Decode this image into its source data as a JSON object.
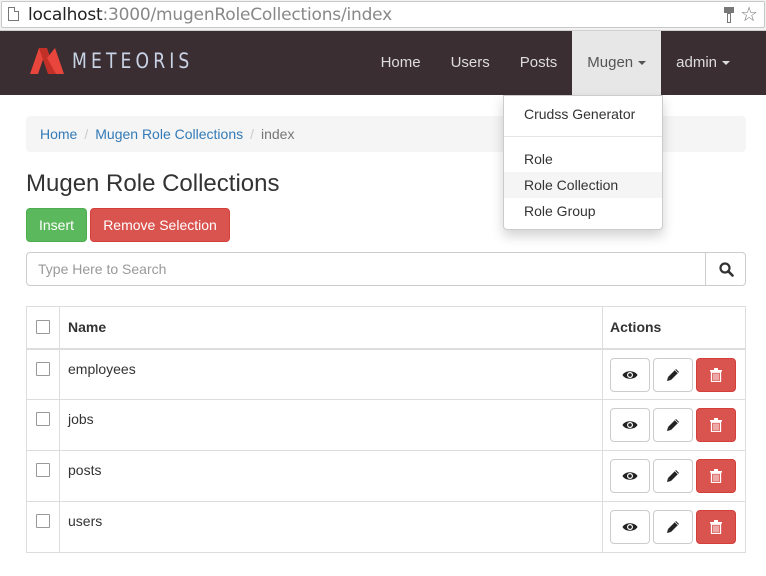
{
  "browser": {
    "url_host": "localhost",
    "url_rest": ":3000/mugenRoleCollections/index"
  },
  "navbar": {
    "brand": "METEORIS",
    "items": [
      {
        "label": "Home"
      },
      {
        "label": "Users"
      },
      {
        "label": "Posts"
      },
      {
        "label": "Mugen"
      },
      {
        "label": "admin"
      }
    ]
  },
  "dropdown": {
    "items": [
      {
        "label": "Crudss Generator"
      },
      {
        "label": "Role"
      },
      {
        "label": "Role Collection"
      },
      {
        "label": "Role Group"
      }
    ]
  },
  "breadcrumb": {
    "items": [
      {
        "label": "Home"
      },
      {
        "label": "Mugen Role Collections"
      }
    ],
    "current": "index"
  },
  "page": {
    "title": "Mugen Role Collections",
    "insert_label": "Insert",
    "remove_label": "Remove Selection"
  },
  "search": {
    "placeholder": "Type Here to Search",
    "value": ""
  },
  "table": {
    "columns": {
      "name": "Name",
      "actions": "Actions"
    },
    "rows": [
      {
        "name": "employees"
      },
      {
        "name": "jobs"
      },
      {
        "name": "posts"
      },
      {
        "name": "users"
      }
    ]
  },
  "colors": {
    "navbar_bg": "#3b2e32",
    "brand_red": "#e8453c",
    "success": "#5cb85c",
    "danger": "#d9534f",
    "link": "#337ab7"
  }
}
